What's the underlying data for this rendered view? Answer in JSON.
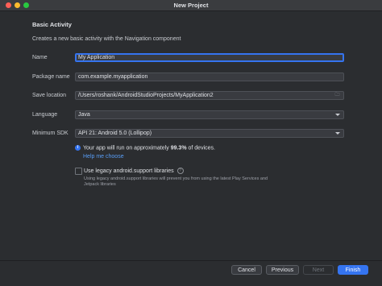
{
  "window": {
    "title": "New Project"
  },
  "header": {
    "heading": "Basic Activity",
    "description": "Creates a new basic activity with the Navigation component"
  },
  "form": {
    "name": {
      "label": "Name",
      "value": "My Application"
    },
    "package": {
      "label": "Package name",
      "value": "com.example.myapplication"
    },
    "save_location": {
      "label": "Save location",
      "value": "/Users/roshank/AndroidStudioProjects/MyApplication2",
      "browse_icon": "folder-icon"
    },
    "language": {
      "label": "Language",
      "value": "Java"
    },
    "min_sdk": {
      "label": "Minimum SDK",
      "value": "API 21: Android 5.0 (Lollipop)"
    }
  },
  "info": {
    "prefix": "Your app will run on approximately ",
    "percent": "99.3%",
    "suffix": " of devices.",
    "help_link": "Help me choose"
  },
  "legacy": {
    "label": "Use legacy android.support libraries",
    "checked": false,
    "note": "Using legacy android.support libraries will prevent you from using the latest Play Services and Jetpack libraries"
  },
  "buttons": {
    "cancel": "Cancel",
    "previous": "Previous",
    "next": "Next",
    "finish": "Finish"
  },
  "colors": {
    "accent": "#3574f0",
    "link": "#589df6",
    "background": "#2b2d30"
  }
}
